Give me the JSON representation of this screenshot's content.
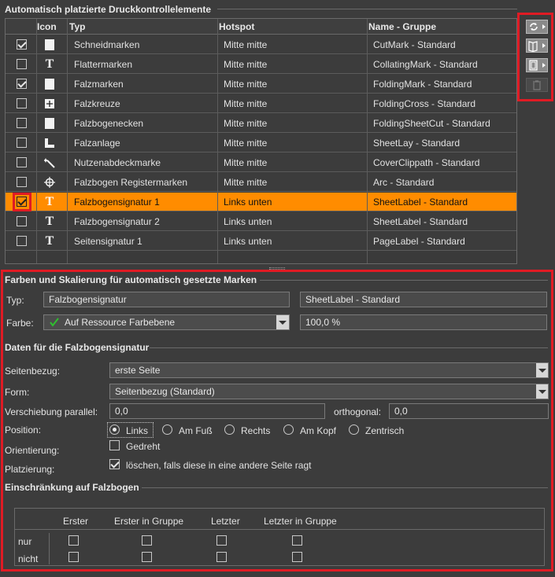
{
  "top_section": {
    "title": "Automatisch platzierte Druckkontrollelemente"
  },
  "table": {
    "columns": [
      "Icon",
      "Typ",
      "Hotspot",
      "Name - Gruppe"
    ],
    "rows": [
      {
        "checked": true,
        "icon": "page-mark-icon",
        "type": "Schneidmarken",
        "hotspot": "Mitte mitte",
        "name": "CutMark - Standard"
      },
      {
        "checked": false,
        "icon": "text-t-icon",
        "type": "Flattermarken",
        "hotspot": "Mitte mitte",
        "name": "CollatingMark - Standard"
      },
      {
        "checked": true,
        "icon": "page-mark-icon",
        "type": "Falzmarken",
        "hotspot": "Mitte mitte",
        "name": "FoldingMark - Standard"
      },
      {
        "checked": false,
        "icon": "fold-cross-icon",
        "type": "Falzkreuze",
        "hotspot": "Mitte mitte",
        "name": "FoldingCross - Standard"
      },
      {
        "checked": false,
        "icon": "page-mark-icon",
        "type": "Falzbogenecken",
        "hotspot": "Mitte mitte",
        "name": "FoldingSheetCut - Standard"
      },
      {
        "checked": false,
        "icon": "sheet-lay-icon",
        "type": "Falzanlage",
        "hotspot": "Mitte mitte",
        "name": "SheetLay - Standard"
      },
      {
        "checked": false,
        "icon": "wand-icon",
        "type": "Nutzenabdeckmarke",
        "hotspot": "Mitte mitte",
        "name": "CoverClippath - Standard"
      },
      {
        "checked": false,
        "icon": "register-mark-icon",
        "type": "Falzbogen Registermarken",
        "hotspot": "Mitte mitte",
        "name": "Arc - Standard"
      },
      {
        "checked": true,
        "icon": "text-t-icon",
        "type": "Falzbogensignatur 1",
        "hotspot": "Links unten",
        "name": "SheetLabel - Standard",
        "selected": true
      },
      {
        "checked": false,
        "icon": "text-t-icon",
        "type": "Falzbogensignatur 2",
        "hotspot": "Links unten",
        "name": "SheetLabel - Standard"
      },
      {
        "checked": false,
        "icon": "text-t-icon",
        "type": "Seitensignatur 1",
        "hotspot": "Links unten",
        "name": "PageLabel - Standard"
      }
    ]
  },
  "toolbar": {
    "buttons": [
      "refresh-icon",
      "book-icon",
      "page-icon",
      "trash-icon"
    ]
  },
  "colors_section": {
    "title": "Farben und Skalierung für automatisch gesetzte Marken",
    "typ_label": "Typ:",
    "typ_value": "Falzbogensignatur",
    "name_value": "SheetLabel - Standard",
    "farbe_label": "Farbe:",
    "farbe_value": "Auf Ressource Farbebene",
    "scale_value": "100,0 %"
  },
  "data_section": {
    "title": "Daten für die Falzbogensignatur",
    "seitenbezug_label": "Seitenbezug:",
    "seitenbezug_value": "erste Seite",
    "form_label": "Form:",
    "form_value": "Seitenbezug (Standard)",
    "parallel_label": "Verschiebung parallel:",
    "parallel_value": "0,0",
    "orthogonal_label": "orthogonal:",
    "orthogonal_value": "0,0",
    "position_label": "Position:",
    "positions": [
      "Links",
      "Am Fuß",
      "Rechts",
      "Am Kopf",
      "Zentrisch"
    ],
    "orientierung_label": "Orientierung:",
    "gedreht_label": "Gedreht",
    "platzierung_label": "Platzierung:",
    "platzierung_option": "löschen, falls diese in eine andere Seite ragt"
  },
  "restriction_section": {
    "title": "Einschränkung auf Falzbogen",
    "columns": [
      "Erster",
      "Erster in Gruppe",
      "Letzter",
      "Letzter in Gruppe"
    ],
    "rows": [
      "nur",
      "nicht"
    ]
  }
}
